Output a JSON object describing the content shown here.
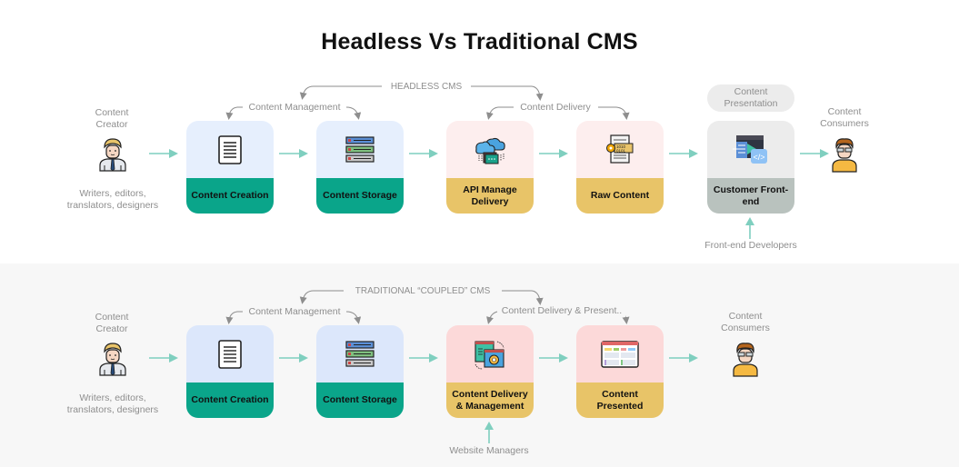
{
  "title": "Headless Vs Traditional CMS",
  "colors": {
    "flow_arrow": "#7fcfbf",
    "connector": "#8e8e8e",
    "blue_card_top": "#e6effd",
    "blue_card_top_traditional": "#dce7fb",
    "teal_card_bottom": "#0aa58a",
    "pink_card_top": "#fdeeee",
    "pink_card_top_traditional": "#fcd9d9",
    "yellow_card_bottom": "#e8c468",
    "gray_card_top": "#ececec",
    "gray_card_bottom": "#b9c2be",
    "band_background": "#f7f7f7"
  },
  "headless": {
    "section_label": "HEADLESS CMS",
    "group_labels": {
      "management": "Content Management",
      "delivery": "Content Delivery"
    },
    "creator": {
      "label": "Content Creator",
      "icon": "businessman-icon",
      "roles": "Writers, editors, translators, designers"
    },
    "steps": [
      {
        "label": "Content Creation",
        "icon": "document-icon",
        "theme": "blue-teal"
      },
      {
        "label": "Content Storage",
        "icon": "server-icon",
        "theme": "blue-teal"
      },
      {
        "label": "API Manage Delivery",
        "icon": "cloud-api-icon",
        "theme": "pink-yellow"
      },
      {
        "label": "Raw Content",
        "icon": "raw-file-icon",
        "theme": "pink-yellow"
      },
      {
        "label": "Customer Front-end",
        "icon": "frontend-code-icon",
        "theme": "gray"
      }
    ],
    "presentation_pill": "Content Presentation",
    "frontend_actor": "Front-end Developers",
    "consumer": {
      "label": "Content Consumers",
      "icon": "consumer-icon"
    }
  },
  "traditional": {
    "section_label": "TRADITIONAL “COUPLED” CMS",
    "group_labels": {
      "management": "Content Management",
      "delivery": "Content Delivery & Present.."
    },
    "creator": {
      "label": "Content Creator",
      "icon": "businessman-icon",
      "roles": "Writers, editors, translators, designers"
    },
    "steps": [
      {
        "label": "Content Creation",
        "icon": "document-icon",
        "theme": "blue-teal"
      },
      {
        "label": "Content Storage",
        "icon": "server-icon",
        "theme": "blue-teal"
      },
      {
        "label": "Content Delivery & Management",
        "icon": "website-settings-icon",
        "theme": "pink-yellow"
      },
      {
        "label": "Content Presented",
        "icon": "web-layout-icon",
        "theme": "pink-yellow"
      }
    ],
    "manager_actor": "Website Managers",
    "consumer": {
      "label": "Content Consumers",
      "icon": "consumer-icon"
    }
  }
}
